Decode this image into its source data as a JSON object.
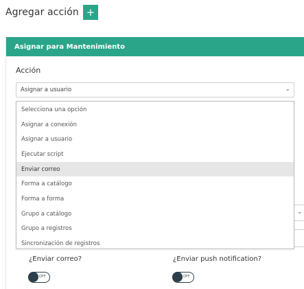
{
  "header": {
    "title": "Agregar acción",
    "add_button": "+"
  },
  "panel": {
    "title": "Asignar para Mantenimiento",
    "field_label": "Acción",
    "select": {
      "value": "Asignar a usuario"
    },
    "dropdown": {
      "options": [
        "Selecciona una opción",
        "Asignar a conexión",
        "Asignar a usuario",
        "Ejecutar script",
        "Enviar correo",
        "Forma a catálogo",
        "Forma a forma",
        "Grupo a catálogo",
        "Grupo a registros",
        "Sincronización de registros"
      ],
      "highlighted": "Enviar correo"
    }
  },
  "toggles": [
    {
      "label": "¿Enviar correo?",
      "state": "OFF"
    },
    {
      "label": "¿Enviar push notification?",
      "state": "OFF"
    }
  ]
}
